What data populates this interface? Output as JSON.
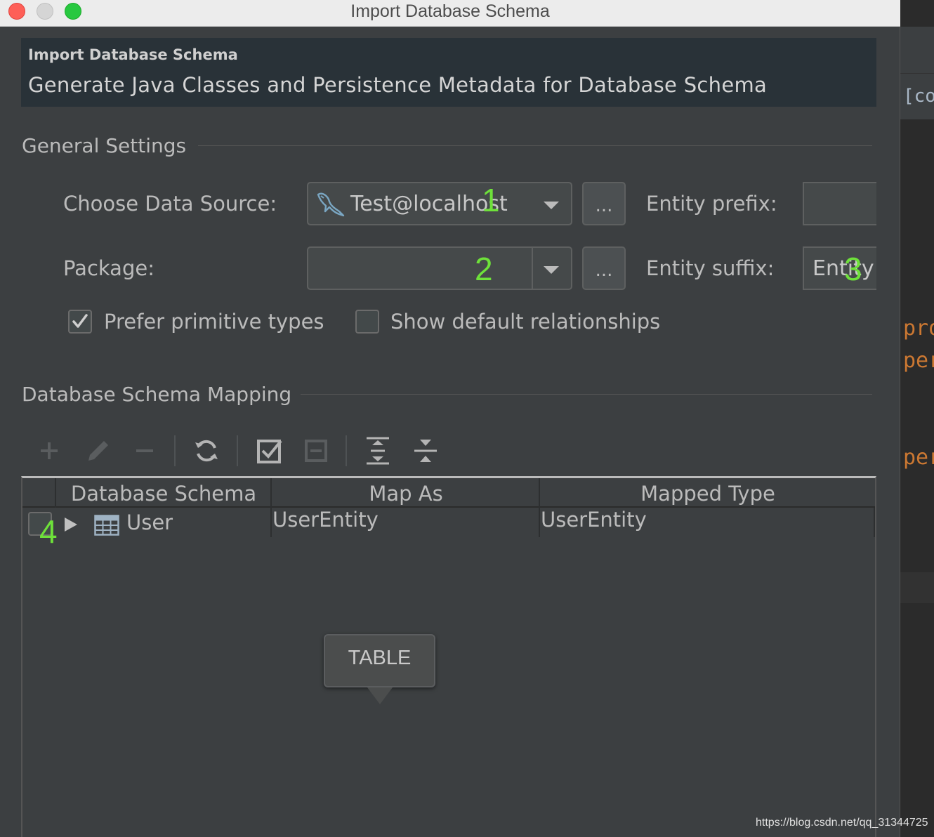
{
  "window": {
    "title": "Import Database Schema",
    "traffic_lights": {
      "close": "#fe5f57",
      "minimize": "#d5d5d5",
      "maximize": "#28c840"
    }
  },
  "banner": {
    "title": "Import Database Schema",
    "subtitle": "Generate Java Classes and Persistence Metadata for Database Schema"
  },
  "general_settings": {
    "section_title": "General Settings",
    "data_source": {
      "label": "Choose Data Source:",
      "value": "Test@localhost",
      "icon": "mysql-dolphin-icon",
      "browse_label": "..."
    },
    "package": {
      "label": "Package:",
      "value": "",
      "browse_label": "..."
    },
    "entity_prefix": {
      "label": "Entity prefix:",
      "value": ""
    },
    "entity_suffix": {
      "label": "Entity suffix:",
      "value": "Entity"
    },
    "prefer_primitive": {
      "label": "Prefer primitive types",
      "checked": true
    },
    "show_default_rel": {
      "label": "Show default relationships",
      "checked": false
    }
  },
  "mapping": {
    "section_title": "Database Schema Mapping",
    "toolbar": [
      "add-icon",
      "edit-icon",
      "remove-icon",
      "refresh-icon",
      "check-all-icon",
      "uncheck-all-icon",
      "expand-all-icon",
      "collapse-all-icon"
    ],
    "columns": [
      "Database Schema",
      "Map As",
      "Mapped Type"
    ],
    "rows": [
      {
        "checked": false,
        "name": "User",
        "map_as": "UserEntity",
        "mapped_type": "UserEntity",
        "icon": "table-icon"
      }
    ],
    "tooltip": "TABLE"
  },
  "annotations": [
    "1",
    "2",
    "3",
    "4"
  ],
  "background_editor": {
    "tab_fragment": "[co",
    "lines": [
      "pro",
      "per",
      "per"
    ]
  },
  "watermark": "https://blog.csdn.net/qq_31344725"
}
